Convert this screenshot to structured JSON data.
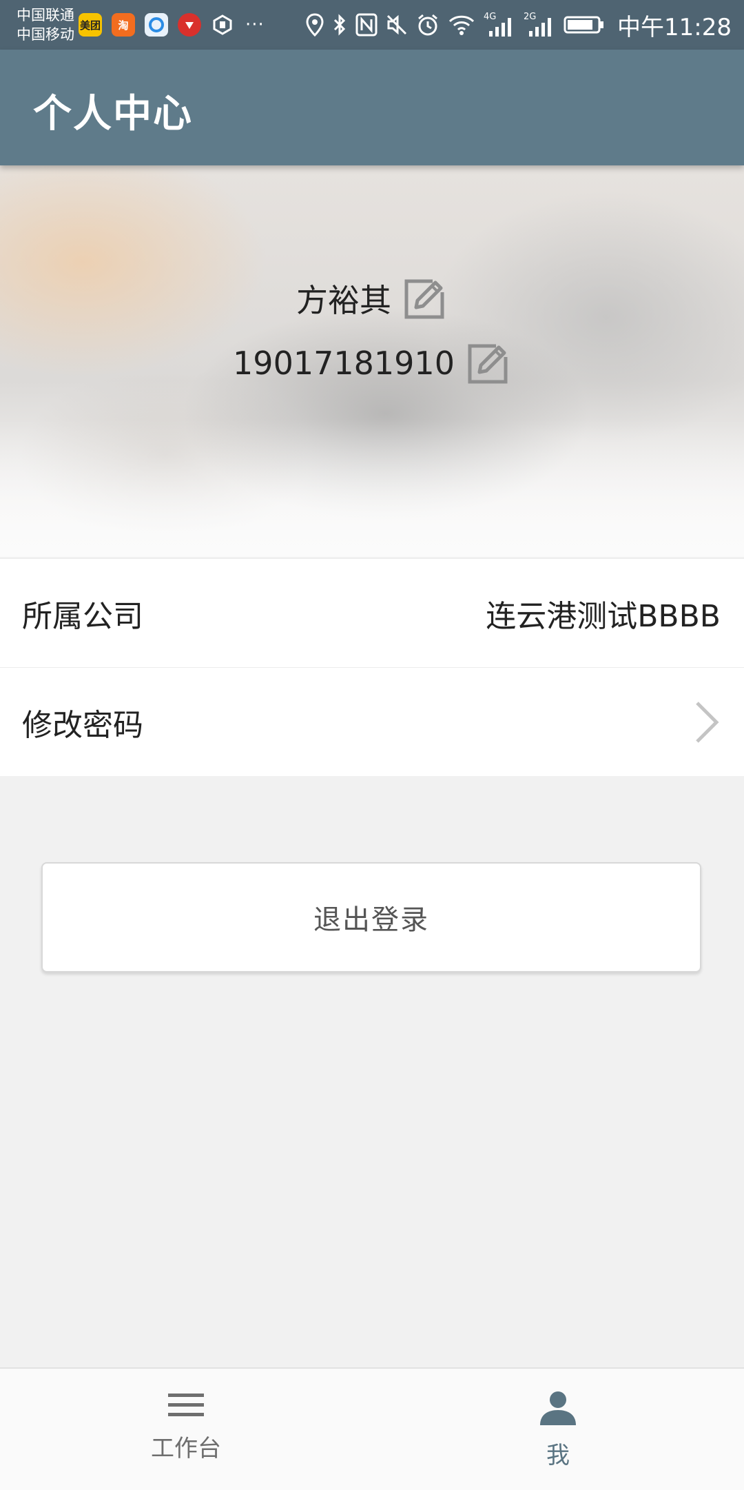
{
  "status_bar": {
    "carrier_1": "中国联通",
    "carrier_2": "中国移动",
    "app_icons": [
      "美团",
      "淘",
      "qq-browser-icon",
      "jd-icon",
      "hex-icon"
    ],
    "more": "···",
    "indicators": [
      "location-icon",
      "bluetooth-icon",
      "nfc-icon",
      "mute-icon",
      "alarm-icon",
      "wifi-icon",
      "signal-4g-icon",
      "signal-2g-icon",
      "battery-icon"
    ],
    "signal_1_label": "4G",
    "signal_2_label": "2G",
    "time": "中午11:28"
  },
  "app_bar": {
    "title": "个人中心"
  },
  "profile": {
    "name": "方裕其",
    "phone": "19017181910"
  },
  "rows": {
    "company_label": "所属公司",
    "company_value": "连云港测试BBBB",
    "password_label": "修改密码"
  },
  "logout": {
    "label": "退出登录"
  },
  "bottom_nav": {
    "items": [
      {
        "label": "工作台",
        "icon": "menu-icon",
        "active": false
      },
      {
        "label": "我",
        "icon": "person-icon",
        "active": true
      }
    ]
  },
  "colors": {
    "status_bar": "#4f6472",
    "app_bar": "#5f7b8a",
    "active_nav": "#5a7482",
    "background": "#f1f1f1"
  }
}
